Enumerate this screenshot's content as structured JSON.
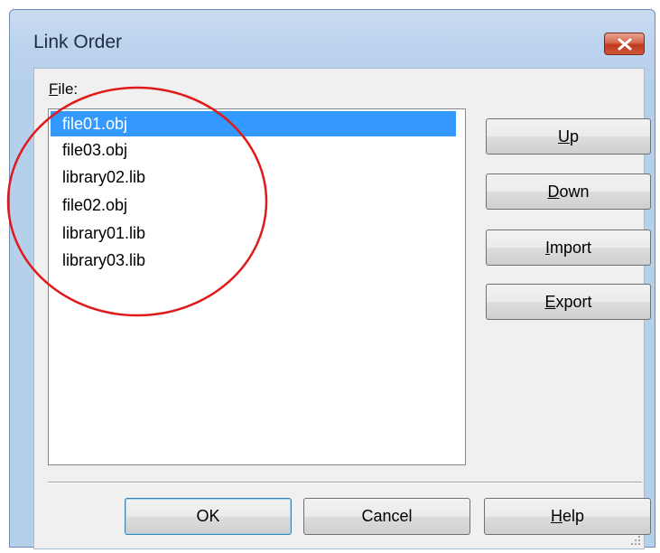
{
  "window": {
    "title": "Link Order"
  },
  "file_label": {
    "mnemonic": "F",
    "rest": "ile:"
  },
  "files": [
    {
      "name": "file01.obj",
      "selected": true
    },
    {
      "name": "file03.obj",
      "selected": false
    },
    {
      "name": "library02.lib",
      "selected": false
    },
    {
      "name": "file02.obj",
      "selected": false
    },
    {
      "name": "library01.lib",
      "selected": false
    },
    {
      "name": "library03.lib",
      "selected": false
    }
  ],
  "buttons": {
    "up": {
      "mnemonic": "U",
      "rest": "p"
    },
    "down": {
      "mnemonic": "D",
      "rest": "own"
    },
    "import": {
      "mnemonic": "I",
      "rest": "mport"
    },
    "export": {
      "mnemonic": "E",
      "rest": "xport"
    },
    "ok": "OK",
    "cancel": "Cancel",
    "help": {
      "mnemonic": "H",
      "rest": "elp"
    }
  },
  "icons": {
    "close": "close-icon",
    "resize": "resize-grip-icon"
  },
  "colors": {
    "selection": "#3399ff",
    "annotation_circle": "#e0191b",
    "close_button": "#c94a31"
  }
}
